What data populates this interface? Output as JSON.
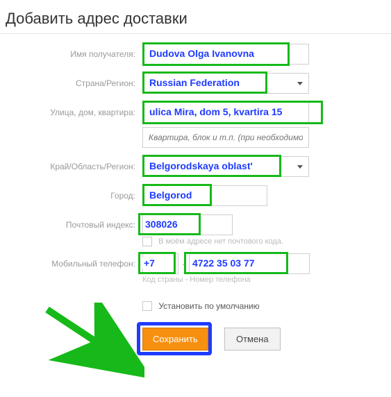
{
  "title": "Добавить адрес доставки",
  "labels": {
    "recipient": "Имя получателя:",
    "country": "Страна/Регион:",
    "street": "Улица, дом, квартира:",
    "addr2_placeholder": "Квартира, блок и т.п. (при необходимости)",
    "region": "Край/Область/Регион:",
    "city": "Город:",
    "zip": "Почтовый индекс:",
    "no_zip": "В моём адресе нет почтового кода.",
    "phone": "Мобильный телефон:",
    "phone_sub": "Код страны - Номер телефона",
    "set_default": "Установить по умолчанию",
    "save": "Сохранить",
    "cancel": "Отмена"
  },
  "values": {
    "recipient": "Dudova Olga Ivanovna",
    "country": "Russian Federation",
    "street": "ulica Mira, dom 5, kvartira 15",
    "region": "Belgorodskaya oblast'",
    "city": "Belgorod",
    "zip": "308026",
    "phone_code": "+7",
    "phone_num": "4722 35 03 77"
  },
  "annotations": {
    "boxes_color": "#16b919",
    "text_color": "#1f3bff",
    "save_highlight_color": "#1f3bff",
    "arrow_color": "#16b919"
  }
}
